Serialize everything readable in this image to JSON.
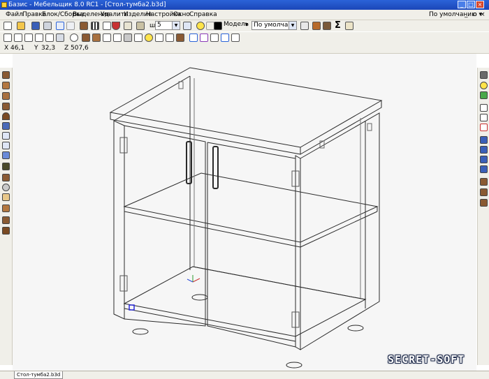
{
  "window": {
    "title": "Базис - Мебельщик 8.0 RC1 - [Стол-тумба2.b3d]"
  },
  "menu": {
    "items": [
      "Файл",
      "Правка",
      "Блок/Сборка",
      "Выделение",
      "Удалить",
      "Изделие",
      "Настройка",
      "Окно",
      "Справка"
    ],
    "preset": "По умолчанию"
  },
  "toolbar": {
    "thickness_label": "ш",
    "thickness_value": "5",
    "view_mode": "Модель",
    "material_preset": "По умолчанию",
    "accent_color": "#2b63d8",
    "icons": [
      "new-file",
      "open-folder",
      "save",
      "print",
      "undo",
      "redo",
      "snap-grid",
      "magnet",
      "measure",
      "lightbulb",
      "color-swatch",
      "sum"
    ]
  },
  "coords": {
    "x_label": "X",
    "x_value": "46,1",
    "y_label": "Y",
    "y_value": "32,3",
    "z_label": "Z",
    "z_value": "507,6"
  },
  "tabs": {
    "document": "Стол-тумба2.b3d"
  },
  "watermark": "SECRET-SOFT",
  "model": {
    "object": "cabinet",
    "doors": 2,
    "shelves": 1
  }
}
